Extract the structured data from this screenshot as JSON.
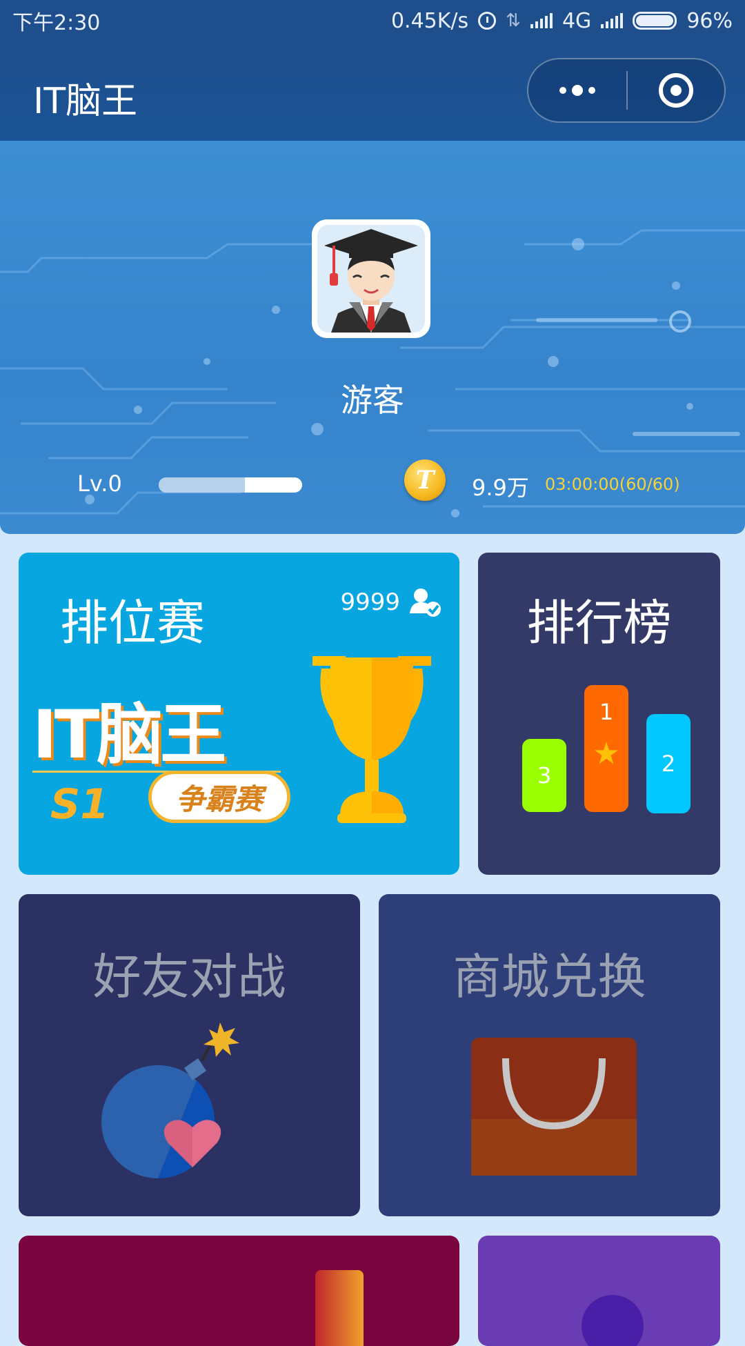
{
  "status_bar": {
    "time": "下午2:30",
    "speed": "0.45K/s",
    "network": "4G",
    "battery": "96%"
  },
  "nav": {
    "title": "IT脑王"
  },
  "profile": {
    "name": "游客",
    "level": "Lv.0",
    "xp_progress": 0.6,
    "coin_symbol": "T",
    "coins": "9.9万",
    "timer": "03:00:00(60/60)"
  },
  "cards": {
    "ranked": {
      "title": "排位赛",
      "online_count": "9999",
      "logo_text": "IT脑王",
      "season": "S1",
      "event": "争霸赛"
    },
    "leaderboard": {
      "title": "排行榜",
      "podium": [
        "3",
        "1",
        "2"
      ]
    },
    "friend_battle": {
      "title": "好友对战"
    },
    "shop": {
      "title": "商城兑换"
    }
  },
  "colors": {
    "nav_bg": "#1f4e8c",
    "page_bg": "#d4e8fb",
    "ranked_card": "#07a6e1",
    "leaderboard_card": "#343a68",
    "friend_card": "#2b3163",
    "shop_card": "#2d3e79",
    "timer_text": "#f6d238"
  },
  "icons": [
    "alarm-icon",
    "signal-icon",
    "battery-icon",
    "more-icon",
    "close-miniprogram-icon",
    "coin-icon",
    "user-check-icon",
    "trophy-icon",
    "bomb-icon",
    "heart-icon",
    "shopping-bag-icon",
    "star-icon"
  ]
}
